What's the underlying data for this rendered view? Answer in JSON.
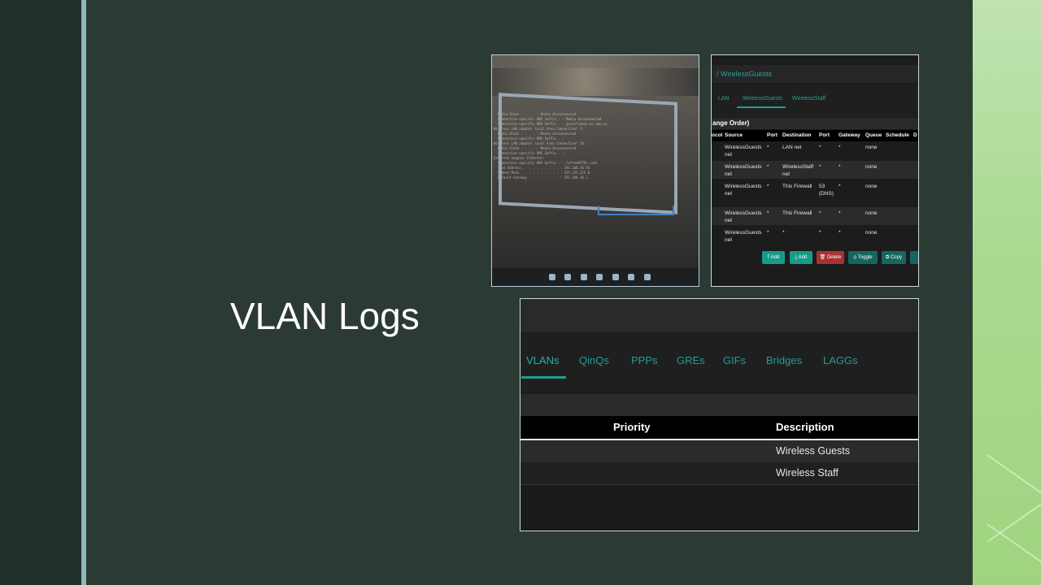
{
  "slide": {
    "title": "VLAN Logs"
  },
  "colors": {
    "background": "#2b3b33",
    "accent_teal": "#1f9e93",
    "right_band": "#a9d98f"
  },
  "photo": {
    "term_lines": [
      "  Media State . . . . : Media disconnected",
      "  Connection-specific DNS Suffix . : Media disconnected",
      "  Connection-specific DNS Suffix . : gssutlsaksh.ac.edu.us",
      "",
      "Wireless LAN adapter Local Area Connection* 1:",
      "",
      "  Media State . . . . : Media disconnected",
      "  Connection-specific DNS Suffix . :",
      "",
      "Wireless LAN adapter Local Area Connection* 10:",
      "",
      "  Media State . . . . : Media disconnected",
      "  Connection-specific DNS Suffix . :",
      "",
      "Ethernet adapter Ethernet:",
      "",
      "  Connection-specific DNS Suffix . : CoffeeBYTES.cafe",
      "  IPv4 Address. . . . . . . . . . : 192.168.10.50",
      "  Subnet Mask . . . . . . . . . . : 255.255.255.0",
      "  Default Gateway . . . . . . . . : 192.168.10.1"
    ]
  },
  "rules": {
    "breadcrumb": "/  WirelessGuests",
    "tabs": [
      "LAN",
      "WirelessGuests",
      "WirelessStaff"
    ],
    "subheader": "ange Order)",
    "columns": [
      "ocol",
      "Source",
      "Port",
      "Destination",
      "Port",
      "Gateway",
      "Queue",
      "Schedule",
      "D"
    ],
    "rows": [
      {
        "source": "WirelessGuests net",
        "sport": "*",
        "dest": "LAN net",
        "dport": "*",
        "gateway": "*",
        "queue": "none"
      },
      {
        "source": "WirelessGuests net",
        "sport": "*",
        "dest": "WirelessStaff net",
        "dport": "*",
        "gateway": "*",
        "queue": "none"
      },
      {
        "source": "WirelessGuests net",
        "sport": "*",
        "dest": "This Firewall",
        "dport": "53 (DNS)",
        "gateway": "*",
        "queue": "none"
      },
      {
        "source": "WirelessGuests net",
        "sport": "*",
        "dest": "This Firewall",
        "dport": "*",
        "gateway": "*",
        "queue": "none"
      },
      {
        "source": "WirelessGuests net",
        "sport": "*",
        "dest": "*",
        "dport": "*",
        "gateway": "*",
        "queue": "none"
      }
    ],
    "buttons": {
      "add_top": "Add",
      "add_bottom": "Add",
      "delete": "Delete",
      "toggle": "Toggle",
      "copy": "Copy"
    }
  },
  "ifaces": {
    "tabs": [
      "VLANs",
      "QinQs",
      "PPPs",
      "GREs",
      "GIFs",
      "Bridges",
      "LAGGs"
    ],
    "columns": {
      "priority": "Priority",
      "description": "Description"
    },
    "rows": [
      {
        "description": "Wireless Guests"
      },
      {
        "description": "Wireless Staff"
      }
    ]
  }
}
